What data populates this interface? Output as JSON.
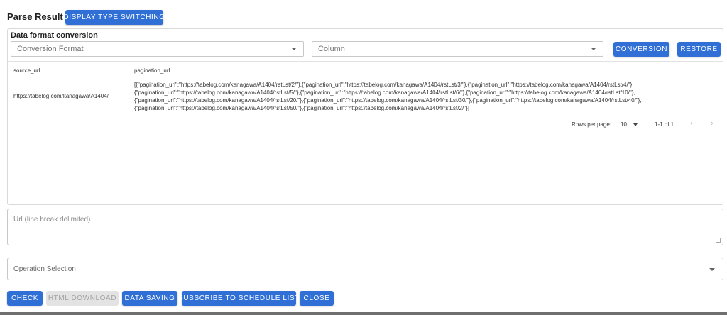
{
  "header": {
    "title": "Parse Result",
    "display_switch_label": "DISPLAY TYPE SWITCHING"
  },
  "conversion": {
    "section_title": "Data format conversion",
    "format_placeholder": "Conversion Format",
    "column_placeholder": "Column",
    "conversion_label": "CONVERSION",
    "restore_label": "RESTORE"
  },
  "table": {
    "columns": [
      "source_url",
      "pagination_url"
    ],
    "rows": [
      {
        "source_url": "https://tabelog.com/kanagawa/A1404/",
        "pagination_url_lines": [
          "[{\"pagination_url\":\"https://tabelog.com/kanagawa/A1404/rstLst/2/\"},{\"pagination_url\":\"https://tabelog.com/kanagawa/A1404/rstLst/3/\"},{\"pagination_url\":\"https://tabelog.com/kanagawa/A1404/rstLst/4/\"},",
          "{\"pagination_url\":\"https://tabelog.com/kanagawa/A1404/rstLst/5/\"},{\"pagination_url\":\"https://tabelog.com/kanagawa/A1404/rstLst/6/\"},{\"pagination_url\":\"https://tabelog.com/kanagawa/A1404/rstLst/10/\"},",
          "{\"pagination_url\":\"https://tabelog.com/kanagawa/A1404/rstLst/20/\"},{\"pagination_url\":\"https://tabelog.com/kanagawa/A1404/rstLst/30/\"},{\"pagination_url\":\"https://tabelog.com/kanagawa/A1404/rstLst/40/\"},",
          "{\"pagination_url\":\"https://tabelog.com/kanagawa/A1404/rstLst/50/\"},{\"pagination_url\":\"https://tabelog.com/kanagawa/A1404/rstLst/2/\"}]"
        ]
      }
    ],
    "pagination": {
      "rows_per_page_label": "Rows per page:",
      "rows_per_page_value": "10",
      "range": "1-1 of 1",
      "prev_icon": "chevron-left-icon",
      "next_icon": "chevron-right-icon"
    }
  },
  "url_input": {
    "placeholder": "Url (line break delimited)"
  },
  "operation": {
    "placeholder": "Operation Selection"
  },
  "actions": {
    "check": "CHECK",
    "html_download": "HTML DOWNLOAD",
    "data_saving": "DATA SAVING",
    "subscribe": "SUBSCRIBE TO SCHEDULE LIST",
    "close": "CLOSE"
  },
  "colors": {
    "primary": "#2f6fd6",
    "disabled_bg": "#e3e3e3",
    "disabled_text": "#a3a3a3"
  }
}
